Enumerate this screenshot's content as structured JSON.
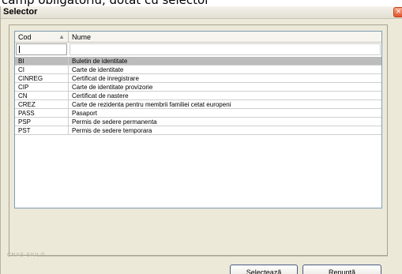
{
  "caption": "camp obligatoriu, dotat cu selector",
  "window": {
    "title": "Selector",
    "close_glyph": "×"
  },
  "grid": {
    "headers": {
      "cod": "Cod",
      "nume": "Nume"
    },
    "sort_indicator": "▲",
    "filter": {
      "cod": "",
      "nume": ""
    },
    "rows": [
      {
        "cod": "BI",
        "nume": "Buletin de identitate",
        "selected": true
      },
      {
        "cod": "CI",
        "nume": "Carte de identitate",
        "selected": false
      },
      {
        "cod": "CINREG",
        "nume": "Certificat de inregistrare",
        "selected": false
      },
      {
        "cod": "CIP",
        "nume": "Carte de identitate provizorie",
        "selected": false
      },
      {
        "cod": "CN",
        "nume": "Certificat de nastere",
        "selected": false
      },
      {
        "cod": "CREZ",
        "nume": "Carte de rezidenta pentru membrii familiei cetat europeni",
        "selected": false
      },
      {
        "cod": "PASS",
        "nume": "Pasaport",
        "selected": false
      },
      {
        "cod": "PSP",
        "nume": "Permis de sedere permanenta",
        "selected": false
      },
      {
        "cod": "PST",
        "nume": "Permis de sedere temporara",
        "selected": false
      }
    ]
  },
  "footer": {
    "label": "CNAS-SIUI ®"
  },
  "buttons": {
    "select": "Selecteazã",
    "cancel": "Renuntã"
  },
  "colors": {
    "selected_row": "#bcbcbc",
    "close_button": "#e0522b",
    "window_bg": "#ece9d8"
  }
}
